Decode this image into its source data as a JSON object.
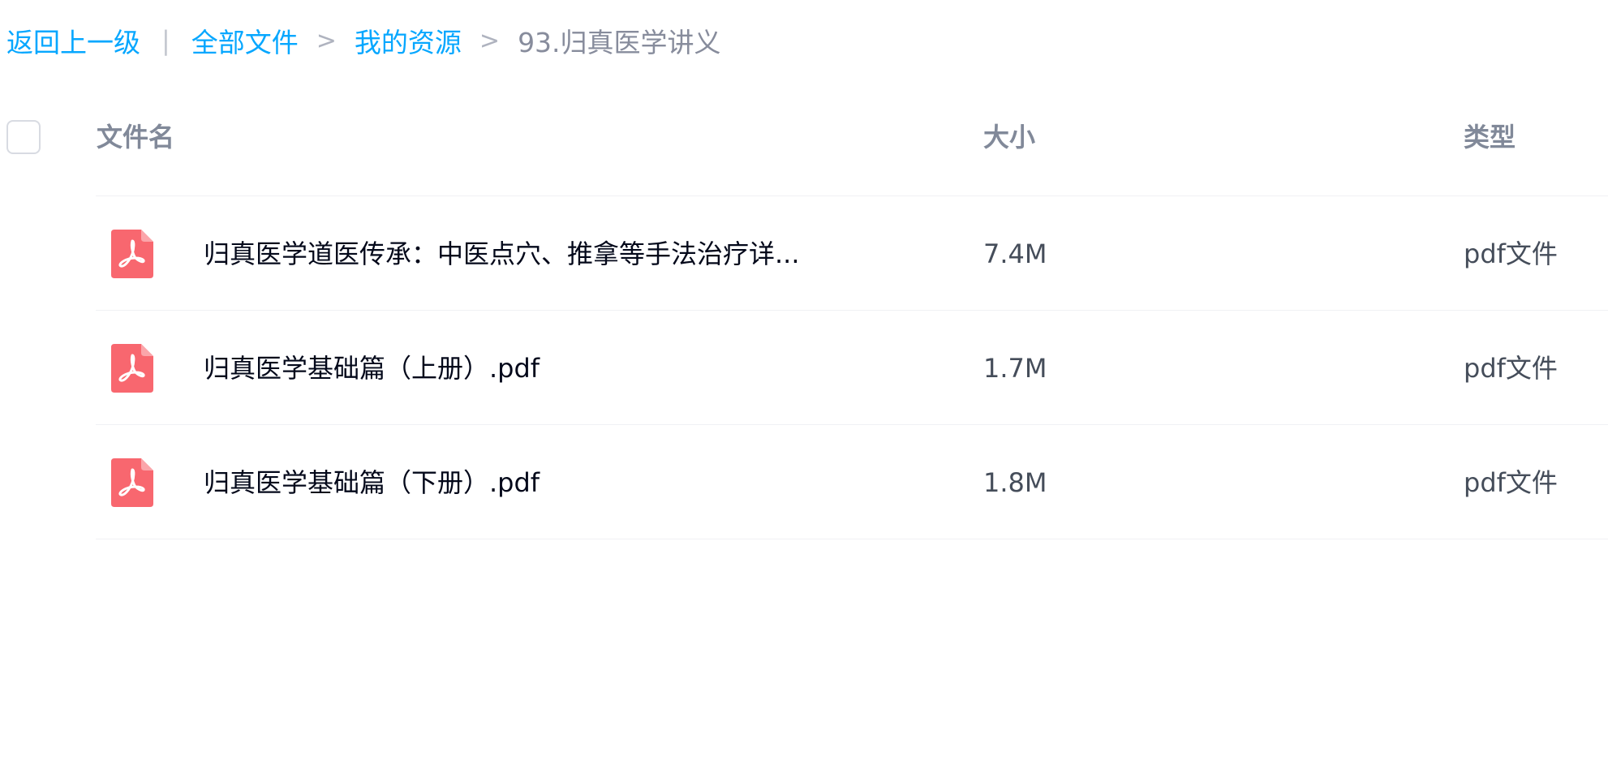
{
  "breadcrumb": {
    "back_label": "返回上一级",
    "separator": "|",
    "arrow": ">",
    "items": [
      "全部文件",
      "我的资源"
    ],
    "current": "93.归真医学讲义"
  },
  "table": {
    "headers": {
      "name": "文件名",
      "size": "大小",
      "type": "类型"
    },
    "rows": [
      {
        "name": "归真医学道医传承：中医点穴、推拿等手法治疗详...",
        "size": "7.4M",
        "type": "pdf文件",
        "icon": "pdf-file-icon"
      },
      {
        "name": "归真医学基础篇（上册）.pdf",
        "size": "1.7M",
        "type": "pdf文件",
        "icon": "pdf-file-icon"
      },
      {
        "name": "归真医学基础篇（下册）.pdf",
        "size": "1.8M",
        "type": "pdf文件",
        "icon": "pdf-file-icon"
      }
    ]
  },
  "colors": {
    "link": "#06a7ff",
    "pdf_icon": "#f8676f",
    "header_text": "#818999",
    "body_text": "#03081a"
  }
}
